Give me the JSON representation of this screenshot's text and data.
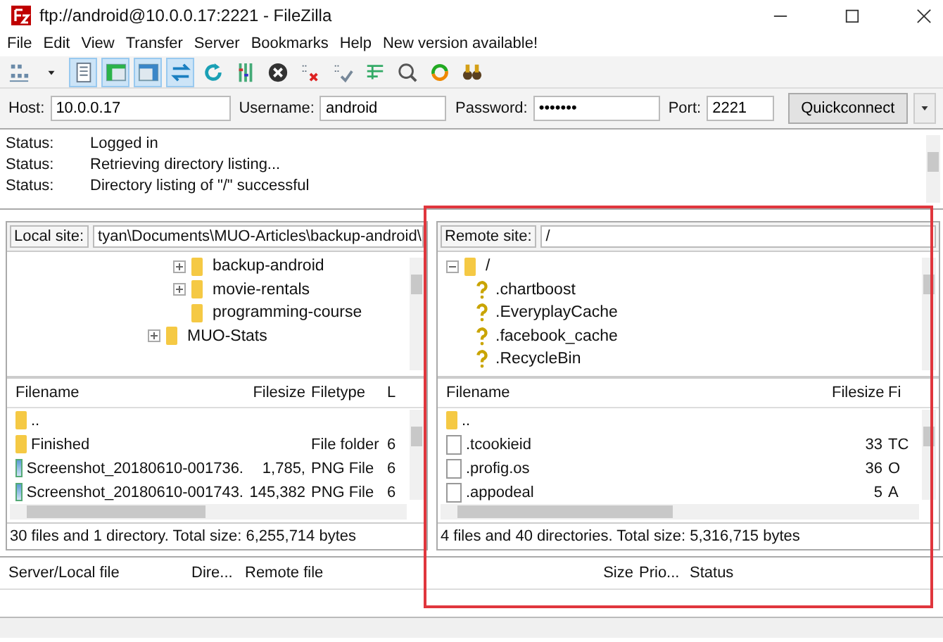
{
  "window": {
    "title": "ftp://android@10.0.0.17:2221 - FileZilla"
  },
  "menu": [
    "File",
    "Edit",
    "View",
    "Transfer",
    "Server",
    "Bookmarks",
    "Help",
    "New version available!"
  ],
  "toolbar": [
    {
      "kind": "sites",
      "on": false
    },
    {
      "kind": "caret",
      "on": false
    },
    {
      "kind": "log",
      "on": true
    },
    {
      "kind": "local-tree",
      "on": true
    },
    {
      "kind": "remote-tree",
      "on": true
    },
    {
      "kind": "queue",
      "on": true
    },
    {
      "kind": "refresh",
      "on": false
    },
    {
      "kind": "filter",
      "on": false
    },
    {
      "kind": "cancel",
      "on": false
    },
    {
      "kind": "disconnect",
      "on": false
    },
    {
      "kind": "reconnect",
      "on": false
    },
    {
      "kind": "compare",
      "on": false
    },
    {
      "kind": "search",
      "on": false
    },
    {
      "kind": "sync",
      "on": false
    },
    {
      "kind": "find",
      "on": false
    }
  ],
  "quickconnect": {
    "fields": [
      {
        "label": "Host:",
        "value": "10.0.0.17"
      },
      {
        "label": "Username:",
        "value": "android"
      },
      {
        "label": "Password:",
        "value": "•••••••"
      },
      {
        "label": "Port:",
        "value": "2221"
      }
    ],
    "button": "Quickconnect"
  },
  "log": [
    {
      "label": "Status:",
      "message": "Logged in"
    },
    {
      "label": "Status:",
      "message": "Retrieving directory listing..."
    },
    {
      "label": "Status:",
      "message": "Directory listing of \"/\" successful"
    }
  ],
  "local": {
    "site_label": "Local site:",
    "path": "tyan\\Documents\\MUO-Articles\\backup-android\\",
    "tree": [
      {
        "children": [
          {
            "label": "backup-android",
            "expandable": true
          },
          {
            "label": "movie-rentals",
            "expandable": true
          },
          {
            "label": "programming-course",
            "expandable": false
          }
        ]
      },
      {
        "label": "MUO-Stats",
        "expandable": true
      }
    ],
    "columns": [
      "Filename",
      "Filesize",
      "Filetype",
      "L"
    ],
    "rows": [
      {
        "kind": "folder",
        "cells": [
          "..",
          "",
          "",
          ""
        ]
      },
      {
        "kind": "folder",
        "cells": [
          "Finished",
          "",
          "File folder",
          "6"
        ]
      },
      {
        "kind": "image",
        "cells": [
          "Screenshot_20180610-001736.",
          "1,785,",
          "PNG File",
          "6"
        ]
      },
      {
        "kind": "image",
        "cells": [
          "Screenshot_20180610-001743.",
          "145,382",
          "PNG File",
          "6"
        ]
      }
    ],
    "status": "30 files and 1 directory. Total size: 6,255,714 bytes"
  },
  "remote": {
    "site_label": "Remote site:",
    "path": "/",
    "tree": [
      {
        "label": "/",
        "expanded": true,
        "children": [
          {
            "label": ".chartboost"
          },
          {
            "label": ".EveryplayCache"
          },
          {
            "label": ".facebook_cache"
          },
          {
            "label": ".RecycleBin"
          }
        ]
      }
    ],
    "columns": [
      "Filename",
      "Filesize",
      "Fi"
    ],
    "rows": [
      {
        "kind": "folder",
        "cells": [
          "..",
          "",
          ""
        ]
      },
      {
        "kind": "file",
        "cells": [
          ".tcookieid",
          "33",
          "TC"
        ]
      },
      {
        "kind": "file",
        "cells": [
          ".profig.os",
          "36",
          "O"
        ]
      },
      {
        "kind": "file",
        "cells": [
          ".appodeal",
          "5",
          "A"
        ]
      }
    ],
    "status": "4 files and 40 directories. Total size: 5,316,715 bytes"
  },
  "queue": {
    "columns": [
      "Server/Local file",
      "Dire...",
      "Remote file",
      "Size",
      "Prio...",
      "Status"
    ]
  }
}
